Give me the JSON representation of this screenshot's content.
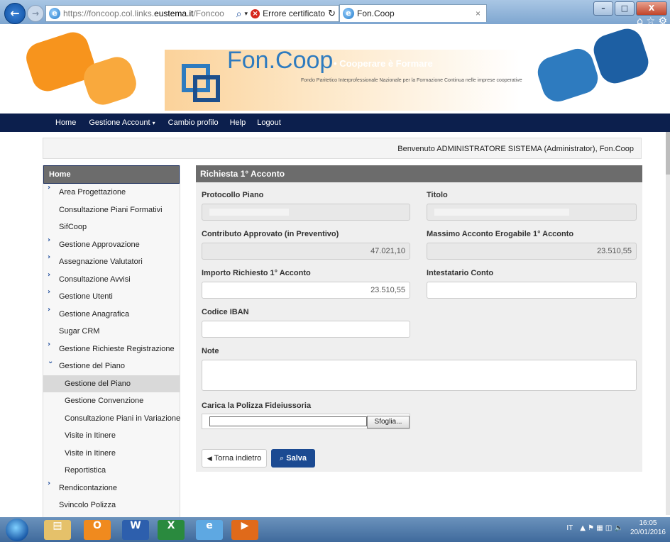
{
  "browser": {
    "url_prefix": "https://foncoop.col.links.",
    "url_domain": "eustema.it",
    "url_suffix": "/Foncoo",
    "cert_error": "Errore certificato",
    "tab_title": "Fon.Coop",
    "tab_close": "×",
    "back_icon": "back-arrow-icon",
    "min": "–",
    "max": "□",
    "close": "X",
    "home_star_gear": "⌂ ☆ ⚙"
  },
  "banner": {
    "brand": "Fon.Coop",
    "tagline": "Cooperare è Formare",
    "dot": "•",
    "subtitle": "Fondo Paritetico Interprofessionale Nazionale per la Formazione Continua nelle imprese cooperative",
    "colors": {
      "orange": "#f7941d",
      "blue": "#2e7bbf"
    }
  },
  "nav": {
    "home": "Home",
    "account": "Gestione Account",
    "account_caret": "▾",
    "profile": "Cambio profilo",
    "help": "Help",
    "logout": "Logout"
  },
  "welcome": "Benvenuto ADMINISTRATORE SISTEMA (Administrator), Fon.Coop",
  "sidebar": {
    "header": "Home",
    "items": [
      {
        "label": "Area Progettazione",
        "chevron": "›"
      },
      {
        "label": "Consultazione Piani Formativi",
        "chevron": ""
      },
      {
        "label": "SifCoop",
        "chevron": ""
      },
      {
        "label": "Gestione Approvazione",
        "chevron": "›"
      },
      {
        "label": "Assegnazione Valutatori",
        "chevron": "›"
      },
      {
        "label": "Consultazione Avvisi",
        "chevron": "›"
      },
      {
        "label": "Gestione Utenti",
        "chevron": "›"
      },
      {
        "label": "Gestione Anagrafica",
        "chevron": "›"
      },
      {
        "label": "Sugar CRM",
        "chevron": ""
      },
      {
        "label": "Gestione Richieste Registrazione",
        "chevron": "›"
      },
      {
        "label": "Gestione del Piano",
        "chevron": "⌄"
      },
      {
        "label": "Gestione del Piano",
        "chevron": ""
      },
      {
        "label": "Gestione Convenzione",
        "chevron": ""
      },
      {
        "label": "Consultazione Piani in Variazione",
        "chevron": ""
      },
      {
        "label": "Visite in Itinere",
        "chevron": ""
      },
      {
        "label": "Visite in Itinere",
        "chevron": ""
      },
      {
        "label": "Reportistica",
        "chevron": ""
      },
      {
        "label": "Rendicontazione",
        "chevron": "›"
      },
      {
        "label": "Svincolo Polizza",
        "chevron": ""
      }
    ]
  },
  "form": {
    "title": "Richiesta 1° Acconto",
    "protocollo_label": "Protocollo Piano",
    "titolo_label": "Titolo",
    "contributo_label": "Contributo Approvato (in Preventivo)",
    "contributo_value": "47.021,10",
    "massimo_label": "Massimo Acconto Erogabile 1° Acconto",
    "massimo_value": "23.510,55",
    "importo_label": "Importo Richiesto 1° Acconto",
    "importo_value": "23.510,55",
    "intestatario_label": "Intestatario Conto",
    "intestatario_value": "",
    "iban_label": "Codice IBAN",
    "iban_value": "",
    "note_label": "Note",
    "note_value": "",
    "polizza_label": "Carica la Polizza Fideiussoria",
    "browse_label": "Sfoglia...",
    "back_label": "Torna indietro",
    "back_icon": "◀",
    "save_label": "Salva",
    "save_icon": "🔍"
  },
  "taskbar": {
    "lang": "IT",
    "time": "16:05",
    "date": "20/01/2016",
    "tray_icons": "▲ ⚑ ▦ ◫ 🔈"
  }
}
